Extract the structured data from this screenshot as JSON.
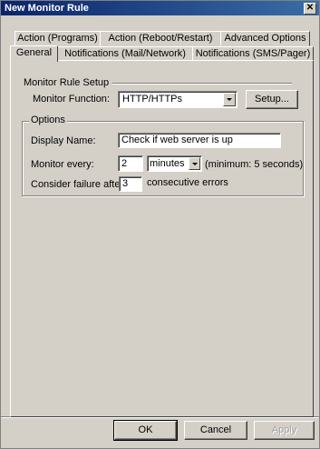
{
  "window": {
    "title": "New Monitor Rule",
    "close_glyph": "✕"
  },
  "tabs": {
    "row1": [
      "Action (Programs)",
      "Action (Reboot/Restart)",
      "Advanced Options"
    ],
    "row2": [
      "General",
      "Notifications (Mail/Network)",
      "Notifications (SMS/Pager)"
    ]
  },
  "setup": {
    "section_title": "Monitor Rule Setup",
    "function_label": "Monitor Function:",
    "function_value": "HTTP/HTTPs",
    "setup_button": "Setup..."
  },
  "options": {
    "group_title": "Options",
    "display_name_label": "Display Name:",
    "display_name_value": "Check if web server is up",
    "monitor_every_label": "Monitor every:",
    "monitor_every_value": "2",
    "unit_value": "minutes",
    "minimum_note": "(minimum: 5 seconds)",
    "failure_label": "Consider failure after:",
    "failure_value": "3",
    "failure_suffix": "consecutive errors"
  },
  "buttons": {
    "ok": "OK",
    "cancel": "Cancel",
    "apply": "Apply"
  }
}
